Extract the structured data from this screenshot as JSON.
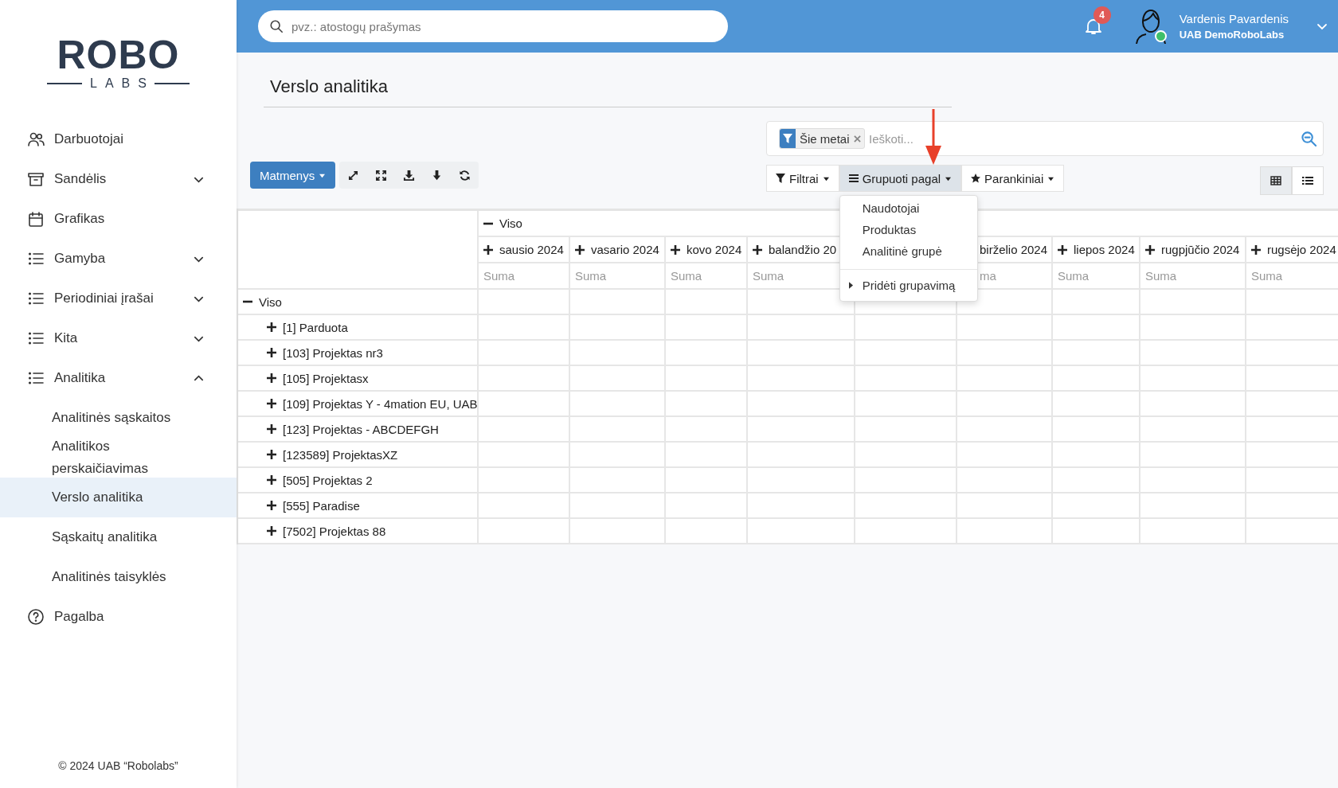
{
  "sidebar": {
    "logo": {
      "word": "ROBO",
      "subword": "LABS"
    },
    "items": [
      {
        "label": "Darbuotojai",
        "selected": false
      },
      {
        "label": "Sandėlis",
        "selected": false,
        "expanded": false
      },
      {
        "label": "Grafikas",
        "selected": false
      },
      {
        "label": "Gamyba",
        "selected": false,
        "expanded": false
      },
      {
        "label": "Periodiniai įrašai",
        "selected": false,
        "expanded": false
      },
      {
        "label": "Kita",
        "selected": false,
        "expanded": false
      },
      {
        "label": "Analitika",
        "selected": false,
        "expanded": true,
        "children": [
          {
            "label": "Analitinės sąskaitos",
            "selected": false
          },
          {
            "label": "Analitikos perskaičiavimas",
            "selected": false
          },
          {
            "label": "Verslo analitika",
            "selected": true
          },
          {
            "label": "Sąskaitų analitika",
            "selected": false
          },
          {
            "label": "Analitinės taisyklės",
            "selected": false
          }
        ]
      },
      {
        "label": "Pagalba",
        "selected": false
      }
    ],
    "footer": "© 2024 UAB “Robolabs”"
  },
  "topbar": {
    "search": {
      "placeholder": "pvz.: atostogų prašymas"
    },
    "notifications": "4",
    "user": {
      "name": "Vardenis Pavardenis",
      "company": "UAB DemoRoboLabs",
      "online": true
    }
  },
  "page_title": "Verslo analitika",
  "toolbar": {
    "dimensions_button": "Matmenys",
    "search": {
      "facet": "Šie metai",
      "placeholder": "Ieškoti..."
    },
    "buttons": [
      {
        "label": "Filtrai",
        "open": false
      },
      {
        "label": "Grupuoti pagal",
        "open": true
      },
      {
        "label": "Parankiniai",
        "open": false
      }
    ],
    "views": [
      {
        "selected": true
      },
      {
        "selected": false
      }
    ],
    "group_menu": {
      "items": [
        {
          "label": "Naudotojai",
          "kind": "option"
        },
        {
          "label": "Produktas",
          "kind": "option"
        },
        {
          "label": "Analitinė grupė",
          "kind": "option"
        },
        {
          "label": "Pridėti grupavimą",
          "kind": "submenu"
        }
      ]
    }
  },
  "pivot": {
    "column_header": {
      "label": "Viso",
      "expanded": true
    },
    "columns": [
      {
        "label": "sausio 2024",
        "measure": "Suma",
        "covered": false,
        "clipped": false
      },
      {
        "label": "vasario 2024",
        "measure": "Suma",
        "covered": false,
        "clipped": false
      },
      {
        "label": "kovo 2024",
        "measure": "Suma",
        "covered": false,
        "clipped": false
      },
      {
        "label": "balandžio 20",
        "measure": "Suma",
        "covered": false,
        "clipped": false
      },
      {
        "covered": true
      },
      {
        "label": "birželio 2024",
        "measure": "ma",
        "covered": false,
        "clipped": true
      },
      {
        "label": "liepos 2024",
        "measure": "Suma",
        "covered": false,
        "clipped": false
      },
      {
        "label": "rugpjūčio 2024",
        "measure": "Suma",
        "covered": false,
        "clipped": false
      },
      {
        "label": "rugsėjo 2024",
        "measure": "Suma",
        "covered": false,
        "clipped": false
      }
    ],
    "row_header": {
      "label": "Viso",
      "expanded": true
    },
    "rows": [
      {
        "label": "[1] Parduota",
        "expanded": false
      },
      {
        "label": "[103] Projektas nr3",
        "expanded": false
      },
      {
        "label": "[105] Projektasx",
        "expanded": false
      },
      {
        "label": "[109] Projektas Y - 4mation EU, UAB",
        "expanded": false
      },
      {
        "label": "[123] Projektas - ABCDEFGH",
        "expanded": false
      },
      {
        "label": "[123589] ProjektasXZ",
        "expanded": false
      },
      {
        "label": "[505] Projektas 2",
        "expanded": false
      },
      {
        "label": "[555] Paradise",
        "expanded": false
      },
      {
        "label": "[7502] Projektas 88",
        "expanded": false
      }
    ]
  }
}
